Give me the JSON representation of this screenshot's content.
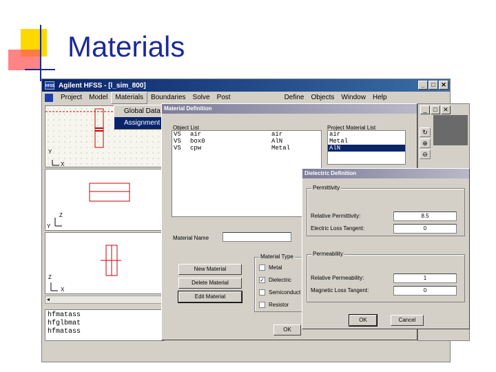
{
  "slide": {
    "title": "Materials"
  },
  "window": {
    "title": "Agilent HFSS - [l_sim_800]",
    "logo_text": "HFSS",
    "buttons": [
      "_",
      "□",
      "✕"
    ]
  },
  "menu": {
    "left": [
      "Project",
      "Model",
      "Materials",
      "Boundaries",
      "Solve",
      "Post"
    ],
    "right": [
      "Define",
      "Objects",
      "Window",
      "Help"
    ]
  },
  "materials_menu": {
    "items": [
      "Global Data",
      "Assignment"
    ],
    "selected": "Assignment"
  },
  "viewports": [
    {
      "axis_v": "Y",
      "axis_h": "X"
    },
    {
      "axis_v": "Z",
      "axis_h": "Y"
    },
    {
      "axis_v": "Z",
      "axis_h": "X"
    }
  ],
  "scroll_arrow": "◂",
  "output_lines": [
    "hfmatass",
    "hfglbmat",
    "hfmatass"
  ],
  "material_definition": {
    "title": "Material Definition",
    "object_list_label": "Object List",
    "objects": [
      {
        "type": "VS",
        "name": "air",
        "material": "air"
      },
      {
        "type": "VS",
        "name": "box0",
        "material": "AlN"
      },
      {
        "type": "VS",
        "name": "cpw",
        "material": "Metal"
      }
    ],
    "project_list_label": "Project Material List",
    "project_materials": [
      "air",
      "Metal",
      "AlN"
    ],
    "selected_project_material": "AlN",
    "material_name_label": "Material Name",
    "material_name_value": "",
    "buttons": {
      "new": "New Material",
      "delete": "Delete Material",
      "edit": "Edit Material",
      "ok": "OK"
    },
    "material_type": {
      "caption": "Material Type",
      "options": [
        {
          "label": "Metal",
          "checked": false
        },
        {
          "label": "Dielectric",
          "checked": true
        },
        {
          "label": "Semiconduct",
          "checked": false
        },
        {
          "label": "Resistor",
          "checked": false
        }
      ]
    }
  },
  "dielectric_definition": {
    "title": "Dielectric Definition",
    "permittivity": {
      "caption": "Permittivity",
      "relative_label": "Relative Permittivity:",
      "relative_value": "8.5",
      "loss_label": "Electric Loss Tangent:",
      "loss_value": "0"
    },
    "permeability": {
      "caption": "Permeability",
      "relative_label": "Relative Permeability:",
      "relative_value": "1",
      "loss_label": "Magnetic Loss Tangent:",
      "loss_value": "0"
    },
    "buttons": {
      "ok": "OK",
      "cancel": "Cancel"
    }
  },
  "colors": {
    "title_blue": "#1b2a99",
    "selection": "#0a246a",
    "model_red": "#cc0000"
  }
}
